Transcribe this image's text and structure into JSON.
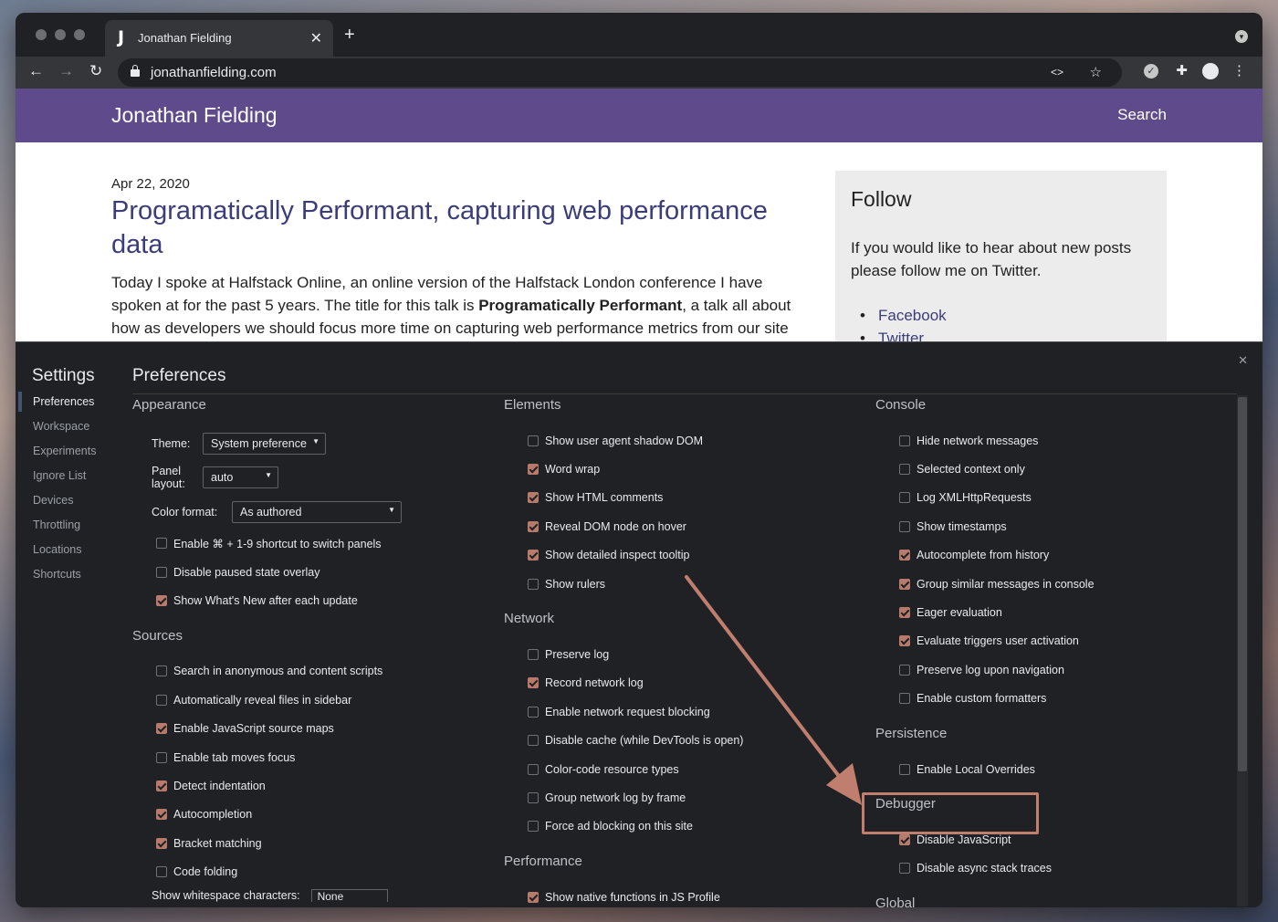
{
  "browser": {
    "tab": {
      "title": "Jonathan Fielding",
      "favicon": "J"
    },
    "url": "jonathanfielding.com"
  },
  "site": {
    "header_title": "Jonathan Fielding",
    "search_label": "Search",
    "post": {
      "date": "Apr 22, 2020",
      "title": "Programatically Performant, capturing web performance data",
      "body_before": "Today I spoke at Halfstack Online, an online version of the Halfstack London conference I have spoken at for the past 5 years. The title for this talk is ",
      "body_bold": "Programatically Performant",
      "body_after": ", a talk all about how as developers we should focus more time on capturing web performance metrics from our site"
    },
    "follow": {
      "title": "Follow",
      "text": "If you would like to hear about new posts please follow me on Twitter.",
      "links": [
        "Facebook",
        "Twitter"
      ]
    }
  },
  "devtools": {
    "settings_title": "Settings",
    "nav": [
      "Preferences",
      "Workspace",
      "Experiments",
      "Ignore List",
      "Devices",
      "Throttling",
      "Locations",
      "Shortcuts"
    ],
    "page_title": "Preferences",
    "appearance": {
      "title": "Appearance",
      "theme_label": "Theme:",
      "theme_value": "System preference",
      "panel_label": "Panel layout:",
      "panel_value": "auto",
      "color_label": "Color format:",
      "color_value": "As authored",
      "checks": [
        {
          "label": "Enable ⌘ + 1-9 shortcut to switch panels",
          "checked": false
        },
        {
          "label": "Disable paused state overlay",
          "checked": false
        },
        {
          "label": "Show What's New after each update",
          "checked": true
        }
      ]
    },
    "sources": {
      "title": "Sources",
      "checks": [
        {
          "label": "Search in anonymous and content scripts",
          "checked": false
        },
        {
          "label": "Automatically reveal files in sidebar",
          "checked": false
        },
        {
          "label": "Enable JavaScript source maps",
          "checked": true
        },
        {
          "label": "Enable tab moves focus",
          "checked": false
        },
        {
          "label": "Detect indentation",
          "checked": true
        },
        {
          "label": "Autocompletion",
          "checked": true
        },
        {
          "label": "Bracket matching",
          "checked": true
        },
        {
          "label": "Code folding",
          "checked": false
        }
      ],
      "whitespace_label": "Show whitespace characters:",
      "whitespace_value": "None"
    },
    "elements": {
      "title": "Elements",
      "checks": [
        {
          "label": "Show user agent shadow DOM",
          "checked": false
        },
        {
          "label": "Word wrap",
          "checked": true
        },
        {
          "label": "Show HTML comments",
          "checked": true
        },
        {
          "label": "Reveal DOM node on hover",
          "checked": true
        },
        {
          "label": "Show detailed inspect tooltip",
          "checked": true
        },
        {
          "label": "Show rulers",
          "checked": false
        }
      ]
    },
    "network": {
      "title": "Network",
      "checks": [
        {
          "label": "Preserve log",
          "checked": false
        },
        {
          "label": "Record network log",
          "checked": true
        },
        {
          "label": "Enable network request blocking",
          "checked": false
        },
        {
          "label": "Disable cache (while DevTools is open)",
          "checked": false
        },
        {
          "label": "Color-code resource types",
          "checked": false
        },
        {
          "label": "Group network log by frame",
          "checked": false
        },
        {
          "label": "Force ad blocking on this site",
          "checked": false
        }
      ]
    },
    "performance": {
      "title": "Performance",
      "checks": [
        {
          "label": "Show native functions in JS Profile",
          "checked": true
        }
      ]
    },
    "console": {
      "title": "Console",
      "checks": [
        {
          "label": "Hide network messages",
          "checked": false
        },
        {
          "label": "Selected context only",
          "checked": false
        },
        {
          "label": "Log XMLHttpRequests",
          "checked": false
        },
        {
          "label": "Show timestamps",
          "checked": false
        },
        {
          "label": "Autocomplete from history",
          "checked": true
        },
        {
          "label": "Group similar messages in console",
          "checked": true
        },
        {
          "label": "Eager evaluation",
          "checked": true
        },
        {
          "label": "Evaluate triggers user activation",
          "checked": true
        },
        {
          "label": "Preserve log upon navigation",
          "checked": false
        },
        {
          "label": "Enable custom formatters",
          "checked": false
        }
      ]
    },
    "persistence": {
      "title": "Persistence",
      "checks": [
        {
          "label": "Enable Local Overrides",
          "checked": false
        }
      ]
    },
    "debugger": {
      "title": "Debugger",
      "checks": [
        {
          "label": "Disable JavaScript",
          "checked": true
        },
        {
          "label": "Disable async stack traces",
          "checked": false
        }
      ]
    },
    "global": {
      "title": "Global"
    }
  },
  "colors": {
    "site_header": "#5f4b8b",
    "link": "#3b3d7a",
    "checkbox_on": "#b87a6b",
    "annotation": "#c07e6f"
  }
}
